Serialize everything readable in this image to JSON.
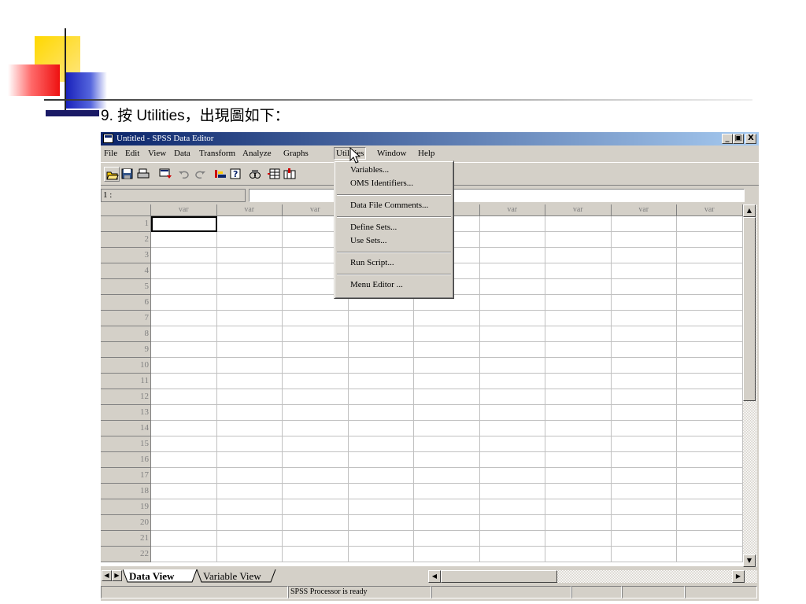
{
  "slide": {
    "title": "9. 按 Utilities，出現圖如下："
  },
  "window": {
    "title": "Untitled - SPSS Data Editor",
    "controls": {
      "minimize": "_",
      "restore": "▣",
      "close": "X"
    }
  },
  "menubar": {
    "items": [
      "File",
      "Edit",
      "View",
      "Data",
      "Transform",
      "Analyze",
      "Graphs",
      "Utilities",
      "Window",
      "Help"
    ],
    "active": "Utilities"
  },
  "utilities_menu": {
    "items": [
      "Variables...",
      "OMS Identifiers...",
      "Data File Comments...",
      "Define Sets...",
      "Use Sets...",
      "Run Script...",
      "Menu Editor ..."
    ]
  },
  "cellbar": {
    "reference": "1 :",
    "value": ""
  },
  "grid": {
    "column_header": "var",
    "columns": [
      "var",
      "var",
      "var",
      "var",
      "var",
      "var",
      "var",
      "var",
      "var"
    ],
    "rows": [
      "1",
      "2",
      "3",
      "4",
      "5",
      "6",
      "7",
      "8",
      "9",
      "10",
      "11",
      "12",
      "13",
      "14",
      "15",
      "16",
      "17",
      "18",
      "19",
      "20",
      "21",
      "22"
    ],
    "selected_cell": "1"
  },
  "tabs": {
    "items": [
      "Data View",
      "Variable View"
    ],
    "active": "Data View"
  },
  "status": {
    "message": "SPSS Processor  is ready"
  },
  "colors": {
    "title_gradient_start": "#0a246a",
    "title_gradient_end": "#a6caf0",
    "chrome": "#d4d0c8",
    "deco_yellow": "#ffcc00",
    "deco_red": "#ff3333",
    "deco_blue": "#2233cc"
  }
}
